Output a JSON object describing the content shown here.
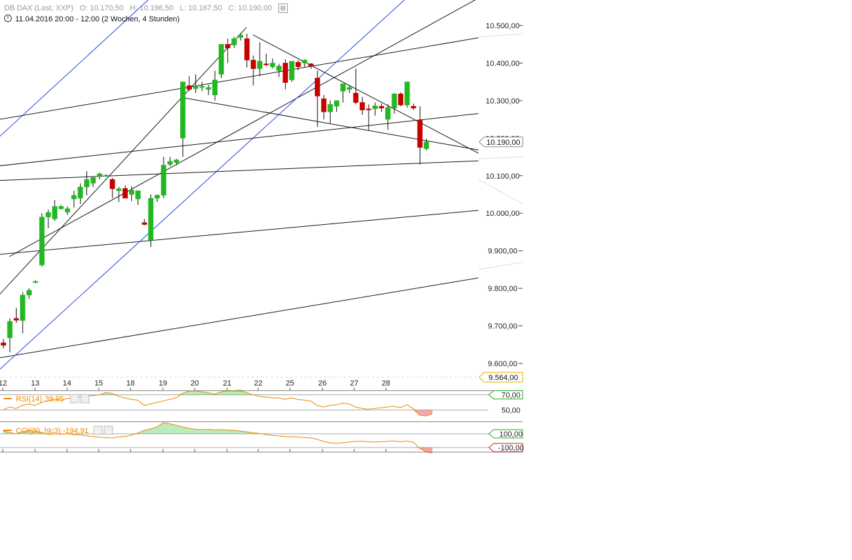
{
  "header": {
    "instrument": "DB DAX (Last, XXP)",
    "open": "O: 10.170,50",
    "high": "H: 10.196,50",
    "low": "L: 10.167,50",
    "close": "C: 10.190,00",
    "range": "11.04.2016 20:00 - 12:00 (2 Wochen, 4 Stunden)"
  },
  "chart_data": [
    {
      "type": "candlestick",
      "ylim": [
        9550,
        10600
      ],
      "y_ticks": [
        10500,
        10400,
        10300,
        10200,
        10100,
        10000,
        9900,
        9800,
        9700,
        9600
      ],
      "y_tick_labels": [
        "10.500,00",
        "10.400,00",
        "10.300,00",
        "10.200,00",
        "10.100,00",
        "10.000,00",
        "9.900,00",
        "9.800,00",
        "9.700,00",
        "9.600,00"
      ],
      "x_tick_labels": [
        "12",
        "13",
        "14",
        "15",
        "18",
        "19",
        "20",
        "21",
        "22",
        "25",
        "26",
        "27",
        "28"
      ],
      "current_price_label": "10.190,00",
      "low_marker_label": "9.564,00",
      "colors": {
        "up": "#22b822",
        "down": "#c80000",
        "trendline": "#1a1a1a",
        "channel": "#2244dd"
      },
      "candles": [
        [
          9655,
          9665,
          9640,
          9648
        ],
        [
          9668,
          9720,
          9630,
          9712
        ],
        [
          9720,
          9748,
          9708,
          9715
        ],
        [
          9714,
          9790,
          9680,
          9782
        ],
        [
          9782,
          9800,
          9772,
          9795
        ],
        [
          9818,
          9822,
          9814,
          9818
        ],
        [
          9862,
          10000,
          9858,
          9990
        ],
        [
          9990,
          10010,
          9960,
          10002
        ],
        [
          9985,
          10035,
          9980,
          10018
        ],
        [
          10012,
          10022,
          10010,
          10018
        ],
        [
          10003,
          10018,
          9995,
          10012
        ],
        [
          10038,
          10060,
          10015,
          10048
        ],
        [
          10040,
          10080,
          10025,
          10070
        ],
        [
          10070,
          10112,
          10048,
          10090
        ],
        [
          10080,
          10096,
          10070,
          10095
        ],
        [
          10098,
          10108,
          10090,
          10105
        ],
        [
          10100,
          10104,
          10097,
          10101
        ],
        [
          10090,
          10094,
          10040,
          10065
        ],
        [
          10060,
          10070,
          10030,
          10065
        ],
        [
          10066,
          10074,
          10050,
          10040
        ],
        [
          10050,
          10072,
          10032,
          10062
        ],
        [
          10038,
          10050,
          10022,
          10060
        ],
        [
          9975,
          9985,
          9968,
          9970
        ],
        [
          9928,
          10050,
          9910,
          10040
        ],
        [
          10040,
          10050,
          10030,
          10048
        ],
        [
          10048,
          10150,
          10040,
          10128
        ],
        [
          10130,
          10150,
          10125,
          10138
        ],
        [
          10135,
          10145,
          10128,
          10142
        ],
        [
          10200,
          10350,
          10150,
          10350
        ],
        [
          10340,
          10365,
          10325,
          10330
        ],
        [
          10332,
          10370,
          10320,
          10340
        ],
        [
          10335,
          10350,
          10325,
          10338
        ],
        [
          10330,
          10342,
          10315,
          10335
        ],
        [
          10315,
          10380,
          10300,
          10355
        ],
        [
          10370,
          10400,
          10360,
          10450
        ],
        [
          10450,
          10465,
          10400,
          10440
        ],
        [
          10448,
          10470,
          10440,
          10465
        ],
        [
          10468,
          10480,
          10460,
          10475
        ],
        [
          10465,
          10478,
          10388,
          10408
        ],
        [
          10408,
          10420,
          10340,
          10385
        ],
        [
          10385,
          10455,
          10365,
          10405
        ],
        [
          10398,
          10425,
          10392,
          10395
        ],
        [
          10390,
          10412,
          10385,
          10400
        ],
        [
          10380,
          10398,
          10363,
          10392
        ],
        [
          10400,
          10410,
          10330,
          10348
        ],
        [
          10355,
          10395,
          10350,
          10405
        ],
        [
          10402,
          10408,
          10380,
          10390
        ],
        [
          10400,
          10410,
          10390,
          10408
        ],
        [
          10398,
          10400,
          10385,
          10392
        ],
        [
          10360,
          10380,
          10230,
          10312
        ],
        [
          10305,
          10315,
          10250,
          10270
        ],
        [
          10270,
          10300,
          10240,
          10290
        ],
        [
          10285,
          10300,
          10270,
          10300
        ],
        [
          10325,
          10345,
          10295,
          10345
        ],
        [
          10330,
          10340,
          10320,
          10335
        ],
        [
          10320,
          10385,
          10290,
          10295
        ],
        [
          10295,
          10310,
          10262,
          10275
        ],
        [
          10278,
          10290,
          10220,
          10276
        ],
        [
          10278,
          10295,
          10260,
          10286
        ],
        [
          10285,
          10292,
          10270,
          10280
        ],
        [
          10250,
          10290,
          10222,
          10282
        ],
        [
          10280,
          10320,
          10265,
          10318
        ],
        [
          10318,
          10322,
          10285,
          10288
        ],
        [
          10288,
          10350,
          10282,
          10350
        ],
        [
          10285,
          10292,
          10275,
          10280
        ],
        [
          10248,
          10285,
          10130,
          10175
        ],
        [
          10172,
          10198,
          10168,
          10190
        ]
      ],
      "trendlines": [
        {
          "from": [
            1,
            9885
          ],
          "to": [
            76,
            10590
          ],
          "color": "#1a1a1a"
        },
        {
          "from": [
            -4,
            9720
          ],
          "to": [
            38,
            10495
          ],
          "color": "#1a1a1a"
        },
        {
          "from": [
            -4,
            10240
          ],
          "to": [
            82,
            10490
          ],
          "color": "#1a1a1a"
        },
        {
          "from": [
            -4,
            10120
          ],
          "to": [
            82,
            10280
          ],
          "color": "#1a1a1a"
        },
        {
          "from": [
            28,
            10308
          ],
          "to": [
            82,
            10145
          ],
          "color": "#1a1a1a"
        },
        {
          "from": [
            39,
            10475
          ],
          "to": [
            82,
            10090
          ],
          "color": "#1a1a1a"
        },
        {
          "from": [
            -4,
            10085
          ],
          "to": [
            82,
            10145
          ],
          "color": "#1a1a1a"
        },
        {
          "from": [
            -4,
            9885
          ],
          "to": [
            82,
            10020
          ],
          "color": "#1a1a1a"
        },
        {
          "from": [
            -4,
            9605
          ],
          "to": [
            82,
            9850
          ],
          "color": "#1a1a1a"
        },
        {
          "from": [
            -4,
            9530
          ],
          "to": [
            82,
            10870
          ],
          "color": "#2244dd"
        },
        {
          "from": [
            -4,
            10150
          ],
          "to": [
            82,
            11500
          ],
          "color": "#2244dd"
        }
      ]
    },
    {
      "type": "line",
      "indicator": "RSI(14)",
      "indicator_value": "39,95",
      "ylim": [
        35,
        75
      ],
      "levels": [
        70,
        50
      ],
      "level_labels": [
        "70,00",
        "50,00"
      ],
      "values": [
        50,
        54,
        52,
        56,
        58,
        56,
        60,
        62,
        64,
        63,
        65,
        66,
        67,
        68,
        69,
        70,
        73,
        72,
        68,
        66,
        64,
        63,
        56,
        58,
        60,
        62,
        64,
        66,
        72,
        76,
        75,
        74,
        73,
        71,
        74,
        77,
        76,
        78,
        73,
        70,
        68,
        67,
        66,
        66,
        64,
        66,
        64,
        63,
        62,
        56,
        54,
        56,
        57,
        59,
        58,
        54,
        52,
        51,
        52,
        53,
        54,
        55,
        53,
        57,
        52,
        43,
        42,
        45
      ]
    },
    {
      "type": "line",
      "indicator": "CCI(20, hlc3)",
      "indicator_value": "-194,91",
      "ylim": [
        -160,
        260
      ],
      "levels": [
        100,
        -100
      ],
      "level_labels": [
        "100,00",
        "-100,00"
      ],
      "values": [
        140,
        120,
        100,
        130,
        150,
        140,
        120,
        90,
        100,
        95,
        100,
        90,
        85,
        70,
        60,
        50,
        45,
        40,
        55,
        60,
        80,
        110,
        150,
        170,
        200,
        260,
        245,
        225,
        200,
        180,
        165,
        160,
        165,
        158,
        160,
        155,
        150,
        140,
        128,
        115,
        105,
        90,
        78,
        70,
        60,
        58,
        52,
        48,
        40,
        20,
        -10,
        -30,
        -40,
        -30,
        -20,
        -10,
        -10,
        -15,
        -20,
        -15,
        -10,
        -5,
        -15,
        -5,
        -20,
        -110,
        -170,
        -190
      ]
    }
  ]
}
